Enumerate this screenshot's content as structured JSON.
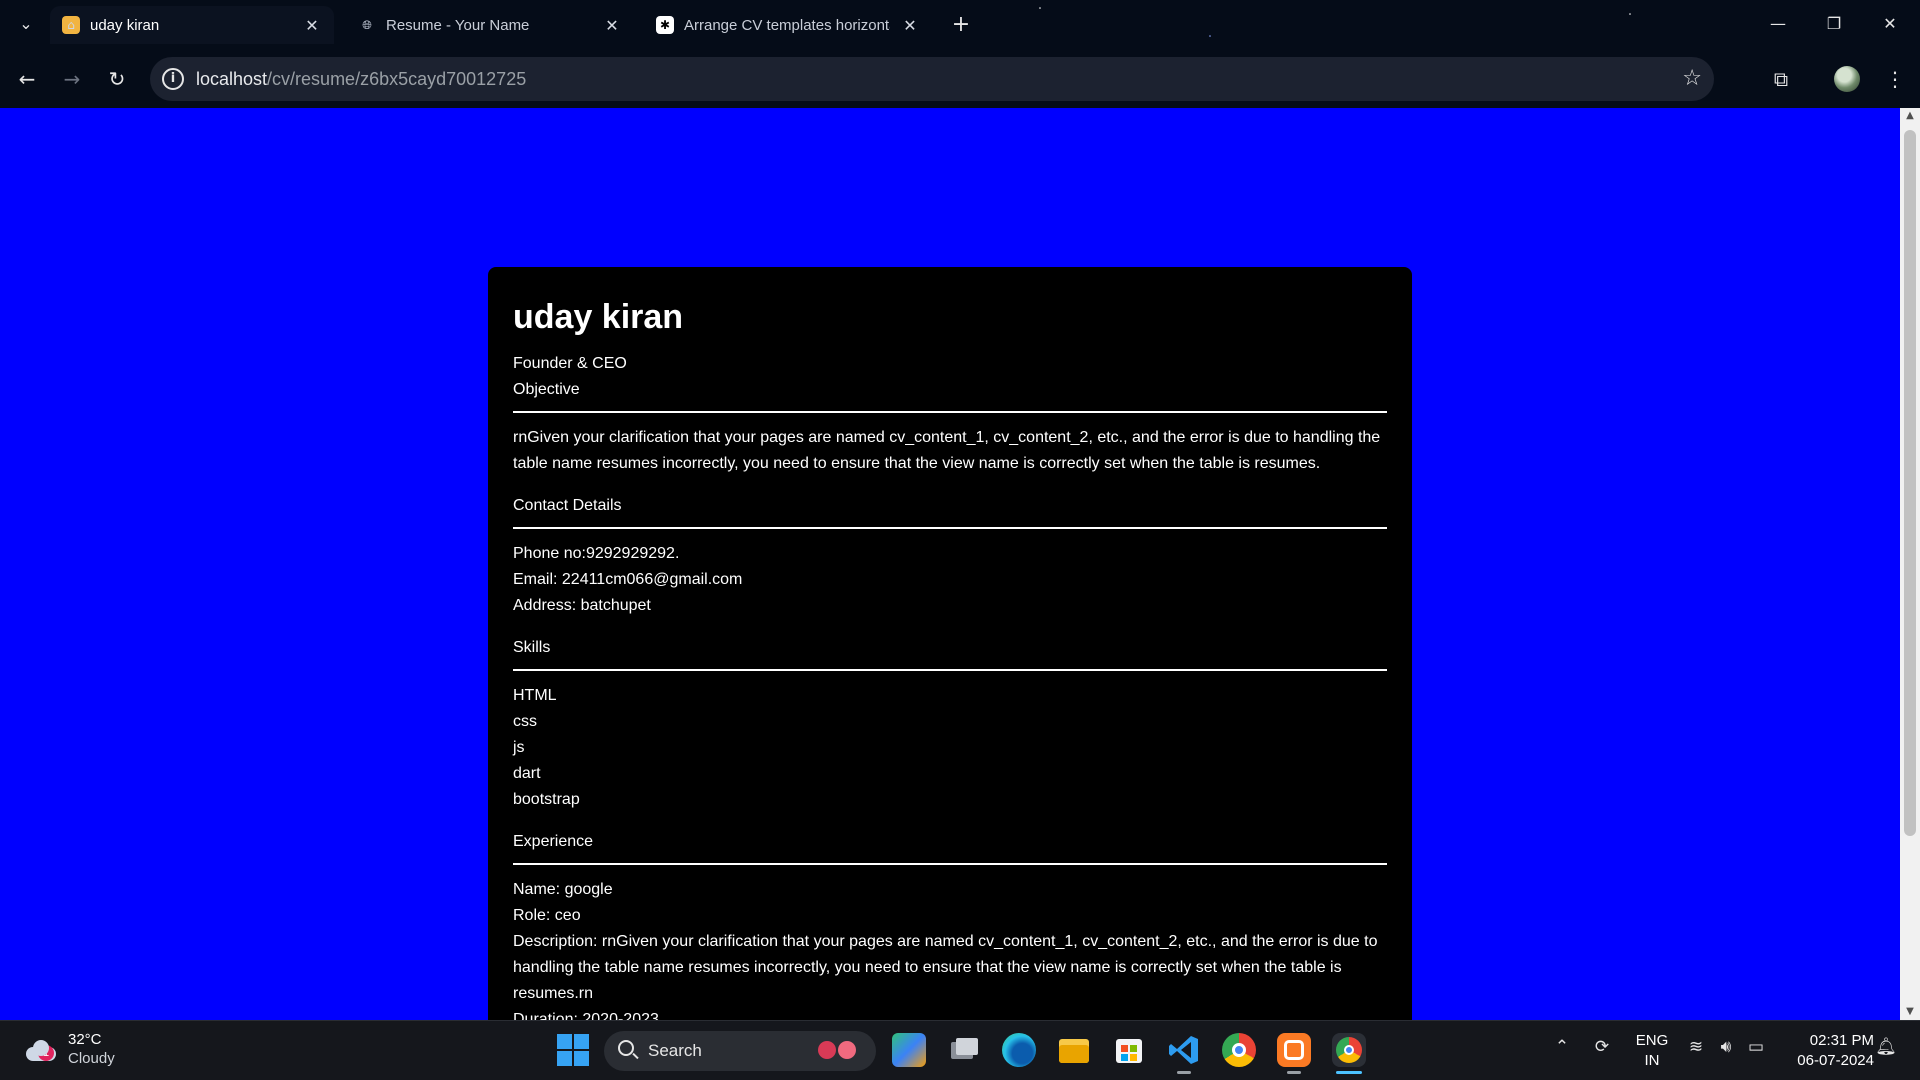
{
  "browser": {
    "tabs": [
      {
        "title": "uday kiran",
        "icon": "home-favicon-icon",
        "active": true
      },
      {
        "title": "Resume - Your Name",
        "icon": "globe-icon",
        "active": false
      },
      {
        "title": "Arrange CV templates horizonta",
        "icon": "chatgpt-icon",
        "active": false
      }
    ],
    "url_host": "localhost",
    "url_path": "/cv/resume/z6bx5cayd70012725"
  },
  "theme": {
    "page_background": "#0000ff",
    "card_background": "#000000",
    "card_text": "#ffffff"
  },
  "resume": {
    "name": "uday kiran",
    "title": "Founder & CEO",
    "objective_heading": "Objective",
    "objective_text": "rnGiven your clarification that your pages are named cv_content_1, cv_content_2, etc., and the error is due to handling the table name resumes incorrectly, you need to ensure that the view name is correctly set when the table is resumes.",
    "contact_heading": "Contact Details",
    "phone": "Phone no:9292929292.",
    "email": "Email: 22411cm066@gmail.com",
    "address": "Address: batchupet",
    "skills_heading": "Skills",
    "skills": [
      "HTML",
      "css",
      "js",
      "dart",
      "bootstrap"
    ],
    "experience_heading": "Experience",
    "experience": {
      "name": "Name: google",
      "role": "Role: ceo",
      "description": "Description: rnGiven your clarification that your pages are named cv_content_1, cv_content_2, etc., and the error is due to handling the table name resumes incorrectly, you need to ensure that the view name is correctly set when the table is resumes.rn",
      "duration_partial": "Duration: 2020-2023"
    }
  },
  "taskbar": {
    "weather_temp": "32°C",
    "weather_condition": "Cloudy",
    "weather_badge": "1",
    "search_placeholder": "Search",
    "language_top": "ENG",
    "language_bottom": "IN",
    "time": "02:31 PM",
    "date": "06-07-2024",
    "pinned_apps": [
      "copilot-icon",
      "task-view-icon",
      "edge-icon",
      "file-explorer-icon",
      "store-icon",
      "vscode-icon",
      "chrome-icon",
      "xampp-icon",
      "chrome-profile-icon"
    ]
  }
}
